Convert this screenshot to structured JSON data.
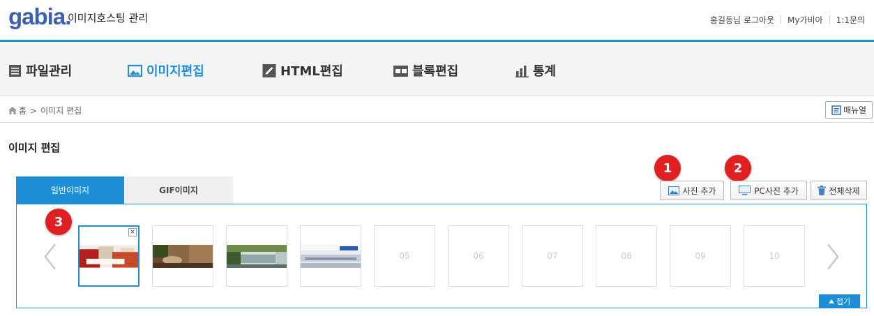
{
  "header": {
    "logo_text": "gabia.",
    "app_title": "이미지호스팅 관리",
    "links": [
      "홍길동님 로그아웃",
      "My가비아",
      "1:1문의"
    ]
  },
  "nav": {
    "items": [
      {
        "label": "파일관리",
        "icon": "file-list-icon",
        "active": false
      },
      {
        "label": "이미지편집",
        "icon": "image-icon",
        "active": true
      },
      {
        "label": "HTML편집",
        "icon": "pencil-icon",
        "active": false
      },
      {
        "label": "블록편집",
        "icon": "block-icon",
        "active": false
      },
      {
        "label": "통계",
        "icon": "bar-chart-icon",
        "active": false
      }
    ]
  },
  "breadcrumb": {
    "home": "홈",
    "separator": ">",
    "current": "이미지 편집"
  },
  "manual_label": "매뉴얼",
  "page_title": "이미지 편집",
  "tabs": {
    "normal": "일반이미지",
    "gif": "GIF이미지"
  },
  "toolbar": {
    "add_photo": "사진 추가",
    "add_pc_photo": "PC사진 추가",
    "delete_all": "전체삭제"
  },
  "badges": [
    "1",
    "2",
    "3"
  ],
  "thumbnails": [
    {
      "slot": "01",
      "filled": true,
      "selected": true
    },
    {
      "slot": "02",
      "filled": true,
      "selected": false
    },
    {
      "slot": "03",
      "filled": true,
      "selected": false
    },
    {
      "slot": "04",
      "filled": true,
      "selected": false
    },
    {
      "slot": "05",
      "filled": false
    },
    {
      "slot": "06",
      "filled": false
    },
    {
      "slot": "07",
      "filled": false
    },
    {
      "slot": "08",
      "filled": false
    },
    {
      "slot": "09",
      "filled": false
    },
    {
      "slot": "10",
      "filled": false
    }
  ],
  "thumb_close": "×",
  "fold_label": "접기",
  "colors": {
    "accent": "#1e8fd6",
    "badge": "#e02020"
  }
}
